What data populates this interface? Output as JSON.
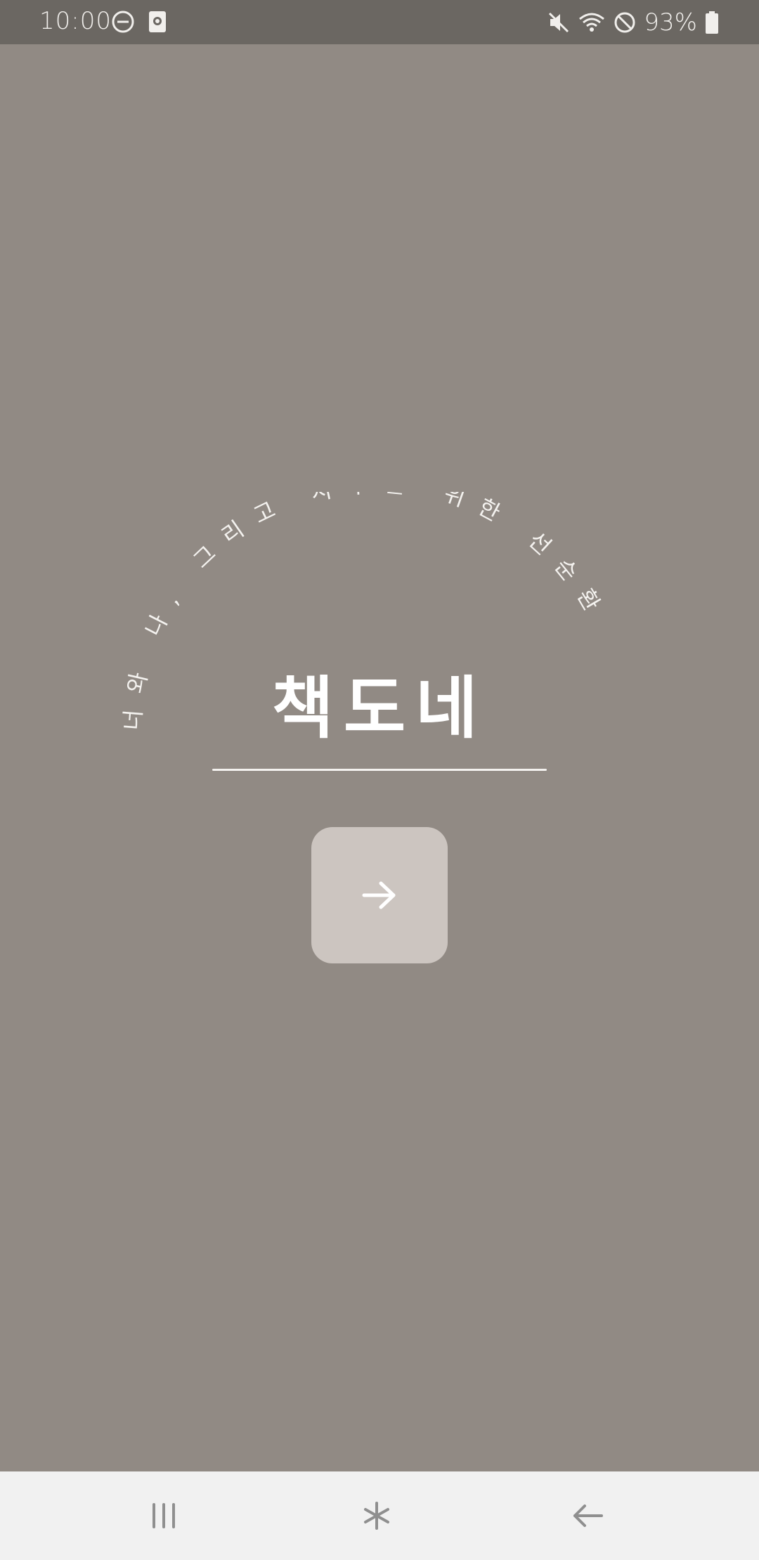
{
  "status_bar": {
    "time": "10:00",
    "battery_percent": "93%",
    "icons": [
      "dnd-minus-icon",
      "screenshot-notification-icon",
      "mute-icon",
      "wifi-icon",
      "no-sync-icon",
      "battery-icon"
    ]
  },
  "splash": {
    "arc_text": "너와 나, 그리고 지구를 위한 선순환",
    "title": "책도네",
    "next_icon": "arrow-right-icon"
  },
  "nav_bar": {
    "icons": [
      "recent-apps-icon",
      "home-icon",
      "back-icon"
    ]
  },
  "colors": {
    "background": "#918a84",
    "status_bar": "#6b6762",
    "button": "#ccc5c0",
    "nav_bar": "#f1f1f1"
  }
}
